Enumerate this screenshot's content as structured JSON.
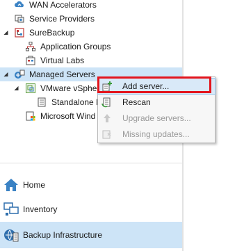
{
  "tree": {
    "wan_accelerators": "WAN Accelerators",
    "service_providers": "Service Providers",
    "surebackup": "SureBackup",
    "application_groups": "Application Groups",
    "virtual_labs": "Virtual Labs",
    "managed_servers": "Managed Servers",
    "vmware_vsphere": "VMware vSphere",
    "standalone_hosts": "Standalone H",
    "microsoft_windows": "Microsoft Wind"
  },
  "nav": {
    "home": "Home",
    "inventory": "Inventory",
    "backup_infrastructure": "Backup Infrastructure"
  },
  "context_menu": {
    "add_server": "Add server...",
    "rescan": "Rescan",
    "upgrade_servers": "Upgrade servers...",
    "missing_updates": "Missing updates..."
  },
  "colors": {
    "selection": "#cde4f7",
    "highlight_outline": "#e3141c",
    "disabled_text": "#9a9a9a"
  }
}
